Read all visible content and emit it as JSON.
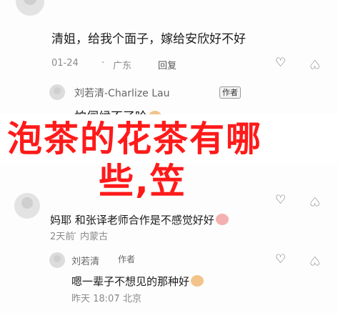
{
  "title": {
    "line1": "泡茶的花茶有哪",
    "line2": "些,笠"
  },
  "comments": [
    {
      "text": "清姐，给我个面子，嫁给安欣好不好",
      "date": "01-24",
      "location": "广东",
      "reply_label": "回复"
    },
    {
      "name": "刘若清-Charlize Lau",
      "author_badge": "作者",
      "text": "怕伺候不了哈"
    },
    {
      "text": "妈耶 和张译老师合作是不感觉好好",
      "date": "2天前",
      "location": "内蒙古"
    },
    {
      "name": "刘若清",
      "author_badge": "作者",
      "text": "嗯一辈子不想见的那种好",
      "date": "昨天 18:07",
      "location": "北京"
    }
  ],
  "icons": {
    "heart": "♡",
    "dislike": "♡"
  }
}
